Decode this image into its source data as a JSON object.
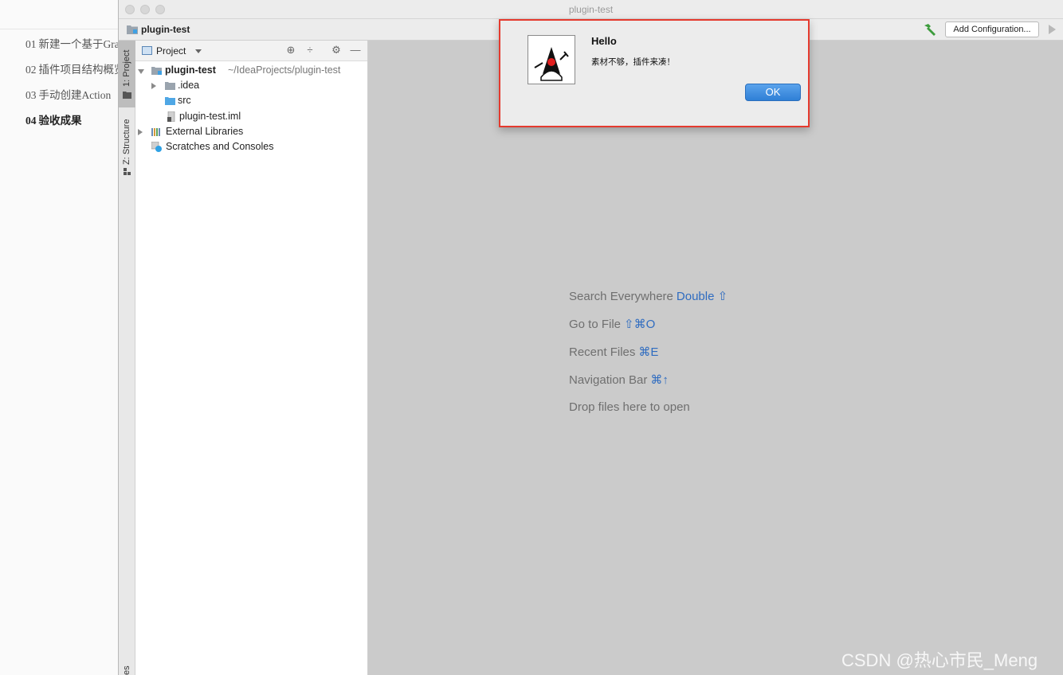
{
  "article": {
    "toc": [
      {
        "num": "01",
        "text": "新建一个基于Gra"
      },
      {
        "num": "02",
        "text": "插件项目结构概览"
      },
      {
        "num": "03",
        "text": "手动创建Action"
      },
      {
        "num": "04",
        "text": "验收成果"
      }
    ]
  },
  "window": {
    "title": "plugin-test"
  },
  "navbar": {
    "project": "plugin-test",
    "add_configuration": "Add Configuration..."
  },
  "stripe": {
    "project_tab": "1: Project",
    "structure_tab": "Z: Structure",
    "bottom_tab": "es"
  },
  "project_panel": {
    "view_label": "Project",
    "tree": [
      {
        "label": "plugin-test",
        "path": "~/IdeaProjects/plugin-test"
      },
      {
        "label": ".idea"
      },
      {
        "label": "src"
      },
      {
        "label": "plugin-test.iml"
      },
      {
        "label": "External Libraries"
      },
      {
        "label": "Scratches and Consoles"
      }
    ]
  },
  "editor": {
    "hints": [
      {
        "text": "Search Everywhere",
        "key": "Double ⇧"
      },
      {
        "text": "Go to File",
        "key": "⇧⌘O"
      },
      {
        "text": "Recent Files",
        "key": "⌘E"
      },
      {
        "text": "Navigation Bar",
        "key": "⌘↑"
      },
      {
        "text": "Drop files here to open",
        "key": ""
      }
    ]
  },
  "dialog": {
    "title": "Hello",
    "message": "素材不够，插件来凑！",
    "ok": "OK",
    "icon": "java-duke-icon"
  },
  "watermark": "CSDN @热心市民_Meng"
}
